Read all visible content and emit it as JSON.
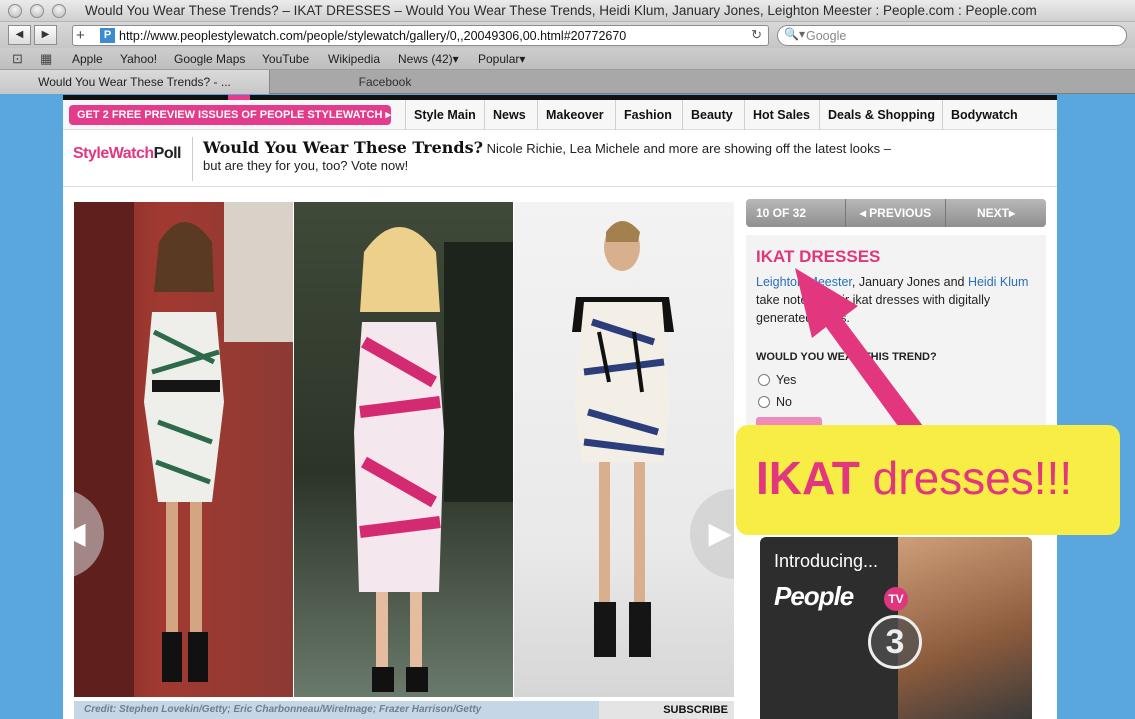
{
  "window": {
    "title": "Would You Wear These Trends? – IKAT DRESSES – Would You Wear These Trends, Heidi Klum, January Jones, Leighton Meester : People.com : People.com"
  },
  "toolbar": {
    "url": "http://www.peoplestylewatch.com/people/stylewatch/gallery/0,,20049306,00.html#20772670",
    "search_placeholder": "Google"
  },
  "bookmarks": [
    "Apple",
    "Yahoo!",
    "Google Maps",
    "YouTube",
    "Wikipedia",
    "News (42)▾",
    "Popular▾"
  ],
  "tabs": [
    "Would You Wear These Trends? - ...",
    "Facebook"
  ],
  "nav": {
    "promo": "GET 2 FREE PREVIEW ISSUES OF PEOPLE STYLEWATCH ▸",
    "links": [
      "Style Main",
      "News",
      "Makeover",
      "Fashion",
      "Beauty",
      "Hot Sales",
      "Deals & Shopping",
      "Bodywatch"
    ]
  },
  "poll": {
    "logo_part1": "StyleWatch",
    "logo_part2": "Poll",
    "title": "Would You Wear These Trends?",
    "description": " Nicole Richie, Lea Michele and more are showing off the latest looks – but are they for you, too? Vote now!"
  },
  "gallery": {
    "counter": "10 OF 32",
    "previous": "◂ PREVIOUS",
    "next": "NEXT▸",
    "credit": "Credit: Stephen Lovekin/Getty; Eric Charbonneau/WireImage; Frazer Harrison/Getty",
    "subscribe": "SUBSCRIBE",
    "prev_arrow": "◀",
    "next_arrow": "▶"
  },
  "trend": {
    "title": "IKAT DRESSES",
    "link1": "Leighton Meester",
    "text1": ", January Jones and ",
    "link2": "Heidi Klum",
    "text2": " take note to their ikat dresses with digitally generated prints.",
    "question": "WOULD YOU WEAR THIS TREND?",
    "options": [
      "Yes",
      "No"
    ]
  },
  "ad": {
    "intro": "Introducing...",
    "brand": "People",
    "badge": "TV",
    "number": "3"
  },
  "annotation": {
    "bold": "IKAT",
    "text": " dresses!!!"
  },
  "colors": {
    "accent_pink": "#e2367e",
    "callout_yellow": "#f8ed44",
    "link_blue": "#2a6fb8"
  }
}
